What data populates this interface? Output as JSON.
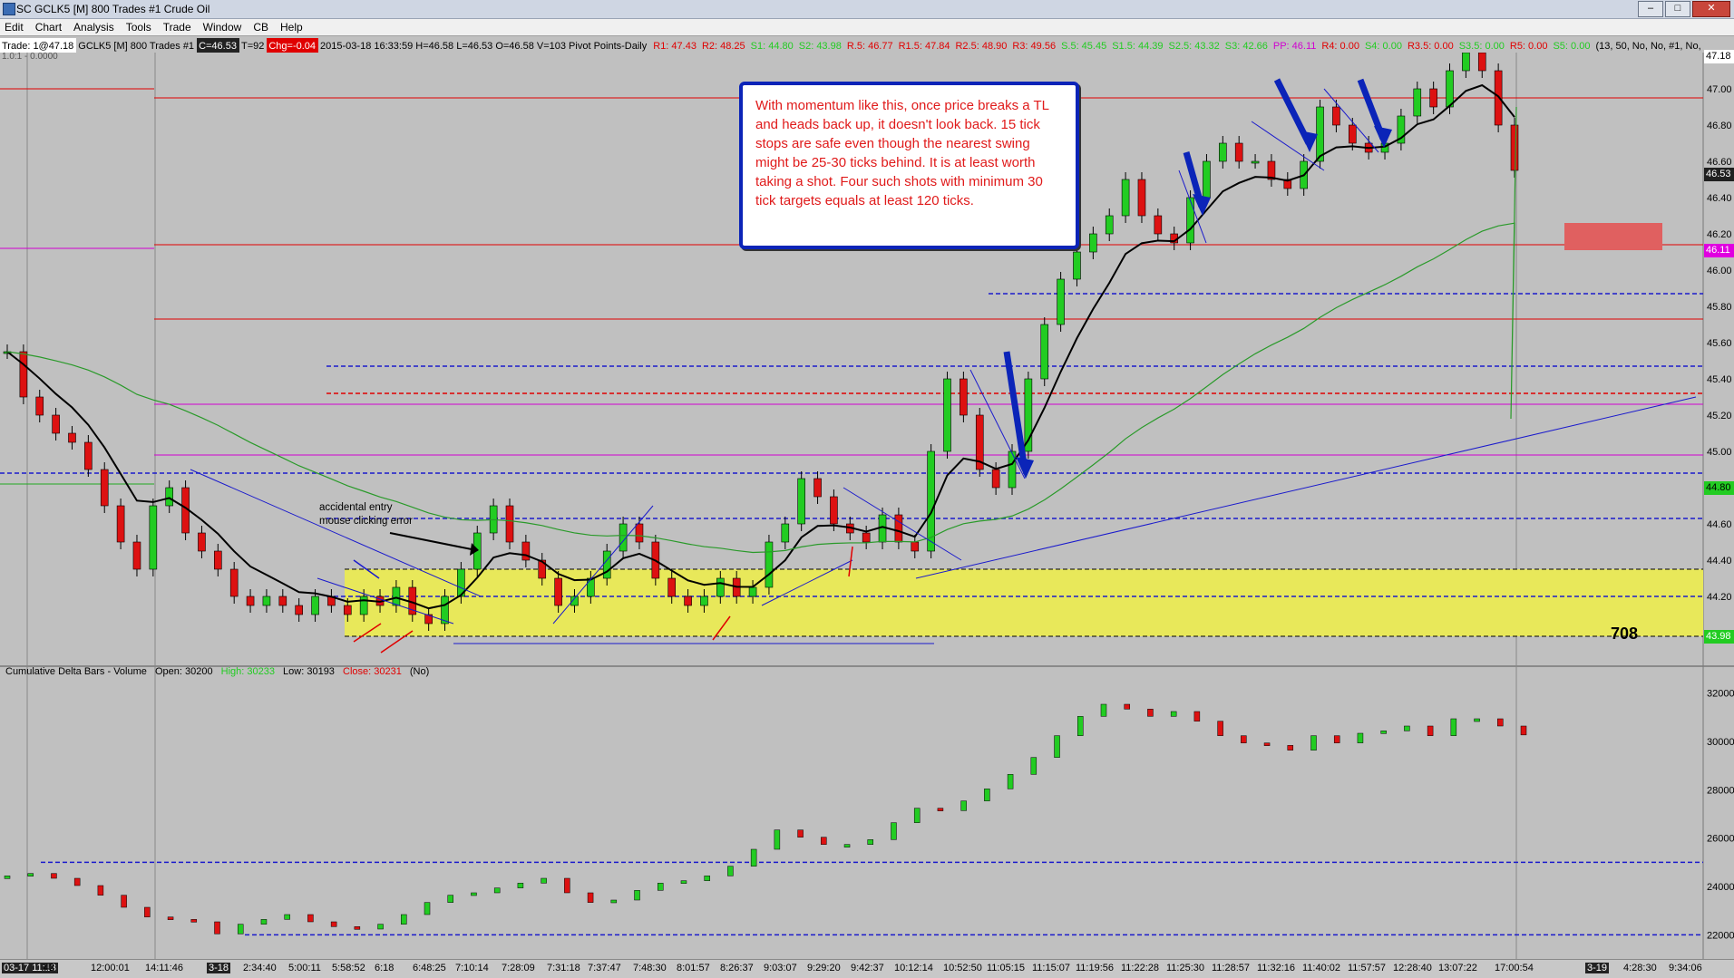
{
  "window": {
    "title": "SC GCLK5 [M]  800 Trades  #1  Crude Oil"
  },
  "menu": [
    "Edit",
    "Chart",
    "Analysis",
    "Tools",
    "Trade",
    "Window",
    "CB",
    "Help"
  ],
  "status": {
    "trade": "Trade: 1@47.18",
    "sub": "1.0:1 - 0.0000",
    "symbol": "GCLK5 [M]  800 Trades  #1",
    "c": "C=46.53",
    "t": "T=92",
    "chg": "Chg=-0.04",
    "bar": "2015-03-18 16:33:59 H=46.58 L=46.53 O=46.58 V=103 Pivot Points-Daily",
    "pivots": [
      {
        "t": "R1: 47.43",
        "c": "#e00000"
      },
      {
        "t": "R2: 48.25",
        "c": "#e00000"
      },
      {
        "t": "S1: 44.80",
        "c": "#22cc22"
      },
      {
        "t": "S2: 43.98",
        "c": "#22cc22"
      },
      {
        "t": "R.5: 46.77",
        "c": "#e00000"
      },
      {
        "t": "R1.5: 47.84",
        "c": "#e00000"
      },
      {
        "t": "R2.5: 48.90",
        "c": "#e00000"
      },
      {
        "t": "R3: 49.56",
        "c": "#e00000"
      },
      {
        "t": "S.5: 45.45",
        "c": "#22cc22"
      },
      {
        "t": "S1.5: 44.39",
        "c": "#22cc22"
      },
      {
        "t": "S2.5: 43.32",
        "c": "#22cc22"
      },
      {
        "t": "S3: 42.66",
        "c": "#22cc22"
      },
      {
        "t": "PP: 46.11",
        "c": "#d000d0"
      },
      {
        "t": "R4: 0.00",
        "c": "#e00000"
      },
      {
        "t": "S4: 0.00",
        "c": "#22cc22"
      },
      {
        "t": "R3.5: 0.00",
        "c": "#e00000"
      },
      {
        "t": "S3.5: 0.00",
        "c": "#22cc22"
      },
      {
        "t": "R5: 0.00",
        "c": "#e00000"
      },
      {
        "t": "S5: 0.00",
        "c": "#22cc22"
      },
      {
        "t": "(13, 50, No, No, #1, No,",
        "c": "#000000"
      }
    ]
  },
  "annotation": "With momentum like this, once price breaks a TL and heads back up, it doesn't look back.  15 tick stops are safe even though the nearest swing might be 25-30 ticks behind.  It is at least worth taking a shot.  Four such shots with minimum 30 tick targets equals at least 120 ticks.",
  "notes": {
    "accidental": "accidental entry",
    "mouse": "mouse clicking error",
    "count": "708"
  },
  "price_axis": [
    "47.18",
    "47.00",
    "46.80",
    "46.60",
    "46.53",
    "46.40",
    "46.20",
    "46.11",
    "46.00",
    "45.80",
    "45.60",
    "45.40",
    "45.20",
    "45.00",
    "44.80",
    "44.60",
    "44.40",
    "44.20",
    "43.98"
  ],
  "price_tags": [
    {
      "label": "47.18",
      "bg": "#ffffff",
      "fg": "#000000",
      "price": 47.18
    },
    {
      "label": "46.53",
      "bg": "#202020",
      "fg": "#ffffff",
      "price": 46.53
    },
    {
      "label": "46.11",
      "bg": "#e000e0",
      "fg": "#ffffff",
      "price": 46.11
    },
    {
      "label": "44.80",
      "bg": "#22cc22",
      "fg": "#000000",
      "price": 44.8
    },
    {
      "label": "43.98",
      "bg": "#22cc22",
      "fg": "#ffffff",
      "price": 43.98
    }
  ],
  "indicator": {
    "name": "Cumulative Delta Bars - Volume",
    "open": "Open: 30200",
    "high": "High: 30233",
    "low": "Low: 30193",
    "close": "Close: 30231",
    "flag": "(No)",
    "axis": [
      "32000",
      "30000",
      "28000",
      "26000",
      "24000",
      "22000"
    ]
  },
  "time_axis": [
    "03-17 11:13",
    "42",
    "12:00:01",
    "14:11:46",
    "3-18",
    "2:34:40",
    "5:00:11",
    "5:58:52",
    "6:18",
    "6:48:25",
    "7:10:14",
    "7:28:09",
    "7:31:18",
    "7:37:47",
    "7:48:30",
    "8:01:57",
    "8:26:37",
    "9:03:07",
    "9:29:20",
    "9:42:37",
    "10:12:14",
    "10:52:50",
    "11:05:15",
    "11:15:07",
    "11:19:56",
    "11:22:28",
    "11:25:30",
    "11:28:57",
    "11:32:16",
    "11:40:02",
    "11:57:57",
    "12:28:40",
    "13:07:22",
    "17:00:54",
    "3-19",
    "4:28:30",
    "9:34:06"
  ],
  "chart_data": {
    "type": "candlestick",
    "symbol": "GCLK5",
    "price_ylim": [
      43.9,
      47.2
    ],
    "delta_ylim": [
      21000,
      33000
    ],
    "pivot_levels": {
      "PP": 46.11,
      "R1": 47.43,
      "S1": 44.8,
      "S2": 43.98,
      "R.5": 46.77,
      "S.5": 45.45,
      "S1.5": 44.39
    },
    "price_path": [
      45.55,
      45.3,
      45.2,
      45.1,
      45.05,
      44.9,
      44.7,
      44.5,
      44.35,
      44.7,
      44.8,
      44.55,
      44.45,
      44.35,
      44.2,
      44.15,
      44.2,
      44.15,
      44.1,
      44.2,
      44.15,
      44.1,
      44.2,
      44.15,
      44.25,
      44.1,
      44.05,
      44.2,
      44.35,
      44.55,
      44.7,
      44.5,
      44.4,
      44.3,
      44.15,
      44.2,
      44.3,
      44.45,
      44.6,
      44.5,
      44.3,
      44.2,
      44.15,
      44.2,
      44.3,
      44.2,
      44.25,
      44.5,
      44.6,
      44.85,
      44.75,
      44.6,
      44.55,
      44.5,
      44.65,
      44.5,
      44.45,
      45.0,
      45.4,
      45.2,
      44.9,
      44.8,
      45.0,
      45.4,
      45.7,
      45.95,
      46.1,
      46.2,
      46.3,
      46.5,
      46.3,
      46.2,
      46.15,
      46.4,
      46.6,
      46.7,
      46.6,
      46.6,
      46.5,
      46.45,
      46.6,
      46.9,
      46.8,
      46.7,
      46.65,
      46.7,
      46.85,
      47.0,
      46.9,
      47.1,
      47.2,
      47.1,
      46.8,
      46.55
    ],
    "delta_path": [
      24400,
      24500,
      24300,
      24000,
      23600,
      23100,
      22700,
      22600,
      22500,
      22000,
      22400,
      22600,
      22800,
      22500,
      22300,
      22200,
      22400,
      22800,
      23300,
      23600,
      23700,
      23900,
      24100,
      24300,
      23700,
      23300,
      23400,
      23800,
      24100,
      24200,
      24400,
      24800,
      25500,
      26300,
      26000,
      25700,
      25700,
      25900,
      26600,
      27200,
      27100,
      27500,
      28000,
      28600,
      29300,
      30200,
      31000,
      31500,
      31300,
      31000,
      31200,
      30800,
      30200,
      29900,
      29800,
      29600,
      30200,
      29900,
      30300,
      30400,
      30600,
      30200,
      30900,
      30900,
      30600,
      30231
    ]
  }
}
